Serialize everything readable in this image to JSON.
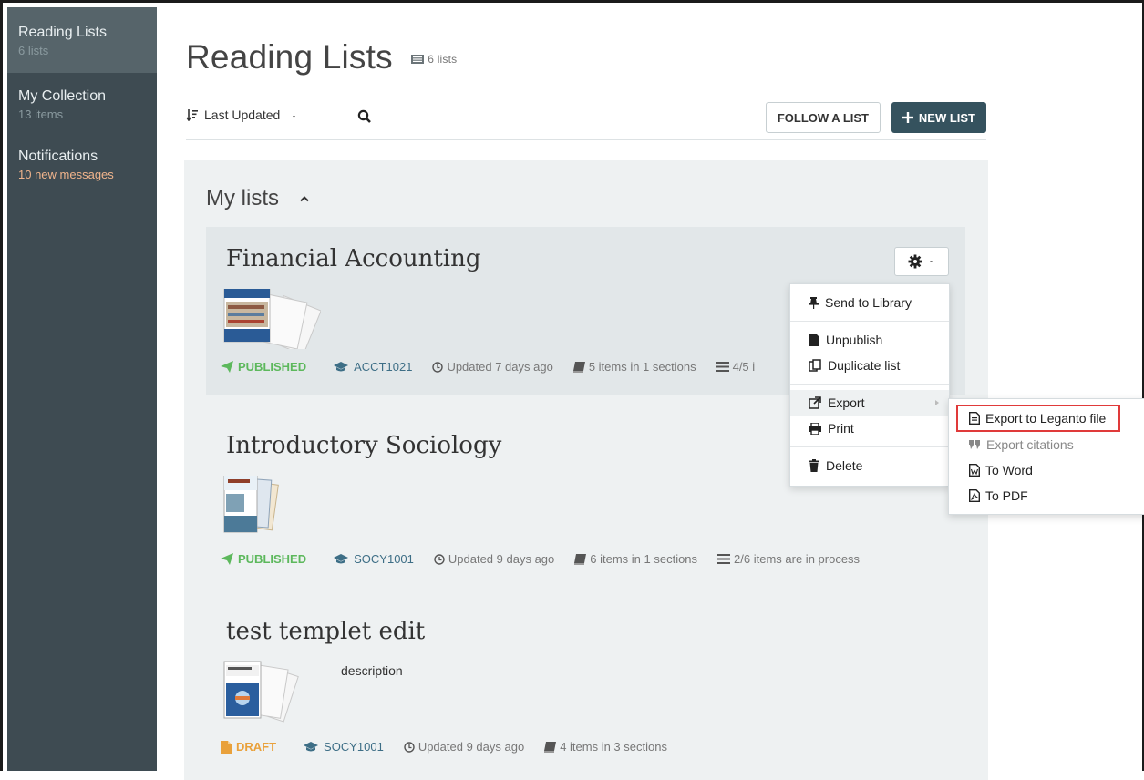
{
  "sidebar": {
    "items": [
      {
        "title": "Reading Lists",
        "sub": "6 lists"
      },
      {
        "title": "My Collection",
        "sub": "13 items"
      },
      {
        "title": "Notifications",
        "sub": "10 new messages"
      }
    ]
  },
  "header": {
    "title": "Reading Lists",
    "count": "6 lists"
  },
  "toolbar": {
    "sort_label": "Last Updated",
    "follow_label": "FOLLOW A LIST",
    "new_label": "NEW LIST"
  },
  "section": {
    "title": "My lists"
  },
  "cards": [
    {
      "title": "Financial Accounting",
      "status": "PUBLISHED",
      "course": "ACCT1021",
      "updated": "Updated 7 days ago",
      "items": "5 items in 1 sections",
      "process": "4/5 i"
    },
    {
      "title": "Introductory Sociology",
      "status": "PUBLISHED",
      "course": "SOCY1001",
      "updated": "Updated 9 days ago",
      "items": "6 items in 1 sections",
      "process": "2/6 items are in process"
    },
    {
      "title": "test templet edit",
      "description": "description",
      "status": "DRAFT",
      "course": "SOCY1001",
      "updated": "Updated 9 days ago",
      "items": "4 items in 3 sections"
    }
  ],
  "menu": {
    "send": "Send to Library",
    "unpublish": "Unpublish",
    "duplicate": "Duplicate list",
    "export": "Export",
    "print": "Print",
    "delete": "Delete"
  },
  "submenu": {
    "leganto": "Export to Leganto file",
    "citations": "Export citations",
    "word": "To Word",
    "pdf": "To PDF"
  }
}
